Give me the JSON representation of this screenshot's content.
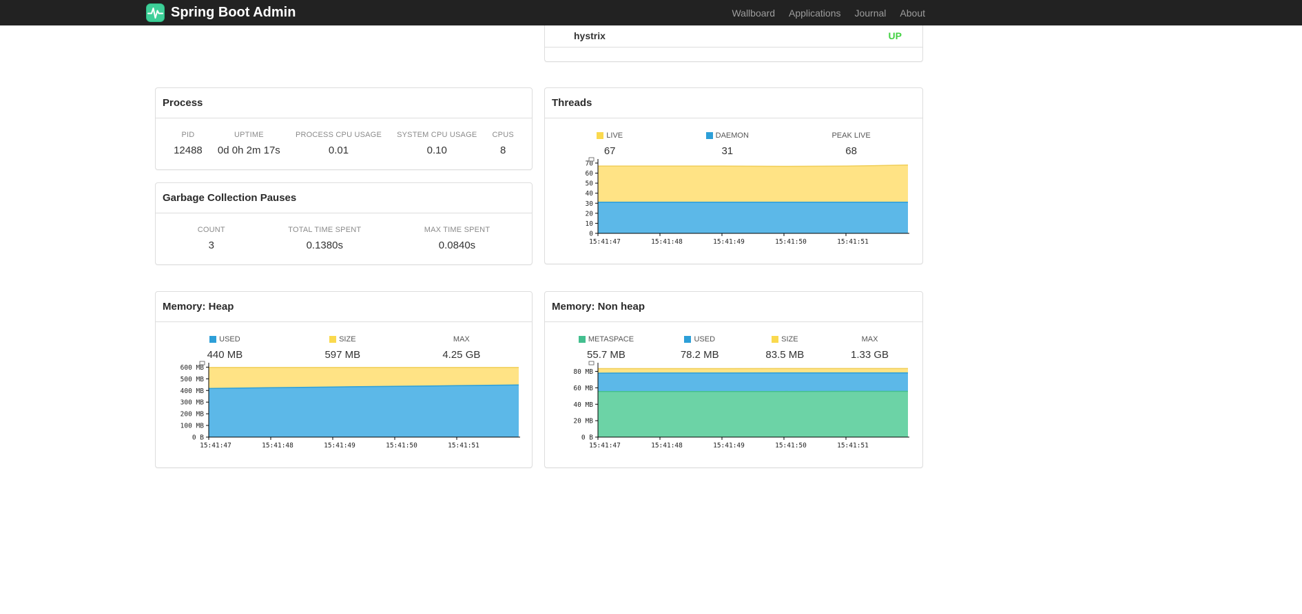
{
  "navbar": {
    "brand": "Spring Boot Admin",
    "items": [
      {
        "label": "Wallboard"
      },
      {
        "label": "Applications"
      },
      {
        "label": "Journal"
      },
      {
        "label": "About"
      }
    ]
  },
  "status_panel": {
    "application": "hystrix",
    "status": "UP",
    "status_color": "#42d142"
  },
  "panels": {
    "process": {
      "title": "Process",
      "stats": [
        {
          "label": "PID",
          "value": "12488"
        },
        {
          "label": "UPTIME",
          "value": "0d 0h 2m 17s"
        },
        {
          "label": "PROCESS CPU USAGE",
          "value": "0.01"
        },
        {
          "label": "SYSTEM CPU USAGE",
          "value": "0.10"
        },
        {
          "label": "CPUS",
          "value": "8"
        }
      ]
    },
    "gc": {
      "title": "Garbage Collection Pauses",
      "stats": [
        {
          "label": "COUNT",
          "value": "3"
        },
        {
          "label": "TOTAL TIME SPENT",
          "value": "0.1380s"
        },
        {
          "label": "MAX TIME SPENT",
          "value": "0.0840s"
        }
      ]
    },
    "threads": {
      "title": "Threads",
      "legend": [
        {
          "label": "LIVE",
          "value": "67",
          "color": "#fad94e"
        },
        {
          "label": "DAEMON",
          "value": "31",
          "color": "#2d9fd8"
        },
        {
          "label": "PEAK LIVE",
          "value": "68"
        }
      ]
    },
    "heap": {
      "title": "Memory: Heap",
      "legend": [
        {
          "label": "USED",
          "value": "440 MB",
          "color": "#2d9fd8"
        },
        {
          "label": "SIZE",
          "value": "597 MB",
          "color": "#fad94e"
        },
        {
          "label": "MAX",
          "value": "4.25 GB"
        }
      ]
    },
    "nonheap": {
      "title": "Memory: Non heap",
      "legend": [
        {
          "label": "METASPACE",
          "value": "55.7 MB",
          "color": "#43bf8f"
        },
        {
          "label": "USED",
          "value": "78.2 MB",
          "color": "#2d9fd8"
        },
        {
          "label": "SIZE",
          "value": "83.5 MB",
          "color": "#fad94e"
        },
        {
          "label": "MAX",
          "value": "1.33 GB"
        }
      ]
    }
  },
  "chart_data": [
    {
      "id": "threads-chart",
      "type": "area",
      "title": "Threads",
      "x_labels": [
        "15:41:47",
        "15:41:48",
        "15:41:49",
        "15:41:50",
        "15:41:51"
      ],
      "ylim": [
        0,
        72
      ],
      "yticks": {
        "values": [
          0,
          10,
          20,
          30,
          40,
          50,
          60,
          70
        ],
        "labels": [
          "0",
          "10",
          "20",
          "30",
          "40",
          "50",
          "60",
          "70"
        ]
      },
      "series": [
        {
          "name": "LIVE",
          "color": "#ffe385",
          "line_color": "#f0ce58",
          "values": [
            67,
            67,
            67,
            66.8,
            67,
            68
          ]
        },
        {
          "name": "DAEMON",
          "color": "#5cb8e8",
          "line_color": "#2d9fd8",
          "values": [
            31,
            31,
            31,
            31,
            31,
            31
          ]
        }
      ],
      "legend_position": "top",
      "grid": false
    },
    {
      "id": "heap-chart",
      "type": "area",
      "title": "Memory: Heap",
      "x_labels": [
        "15:41:47",
        "15:41:48",
        "15:41:49",
        "15:41:50",
        "15:41:51"
      ],
      "ylim": [
        0,
        620
      ],
      "yticks": {
        "values": [
          0,
          100,
          200,
          300,
          400,
          500,
          600
        ],
        "labels": [
          "0 B",
          "100 MB",
          "200 MB",
          "300 MB",
          "400 MB",
          "500 MB",
          "600 MB"
        ]
      },
      "series": [
        {
          "name": "SIZE",
          "color": "#ffe385",
          "line_color": "#f0ce58",
          "values": [
            597,
            597,
            597,
            597,
            597,
            597
          ]
        },
        {
          "name": "USED",
          "color": "#5cb8e8",
          "line_color": "#2d9fd8",
          "values": [
            417,
            424,
            430,
            436,
            441,
            447
          ]
        }
      ],
      "legend_position": "top",
      "grid": false
    },
    {
      "id": "nonheap-chart",
      "type": "area",
      "title": "Memory: Non heap",
      "x_labels": [
        "15:41:47",
        "15:41:48",
        "15:41:49",
        "15:41:50",
        "15:41:51"
      ],
      "ylim": [
        0,
        88
      ],
      "yticks": {
        "values": [
          0,
          20,
          40,
          60,
          80
        ],
        "labels": [
          "0 B",
          "20 MB",
          "40 MB",
          "60 MB",
          "80 MB"
        ]
      },
      "series": [
        {
          "name": "SIZE",
          "color": "#ffe385",
          "line_color": "#f0ce58",
          "values": [
            83.4,
            83.4,
            83.4,
            83.5,
            83.5,
            83.5
          ]
        },
        {
          "name": "USED",
          "color": "#5cb8e8",
          "line_color": "#2d9fd8",
          "values": [
            77.9,
            78,
            78,
            78.1,
            78.2,
            78.2
          ]
        },
        {
          "name": "METASPACE",
          "color": "#6cd3a6",
          "line_color": "#43bf8f",
          "values": [
            55.5,
            55.5,
            55.6,
            55.6,
            55.7,
            55.7
          ]
        }
      ],
      "legend_position": "top",
      "grid": false
    }
  ]
}
